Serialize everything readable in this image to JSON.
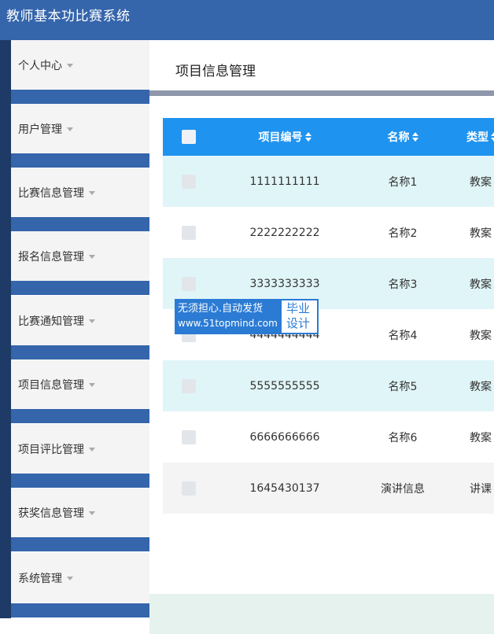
{
  "app": {
    "title": "教师基本功比赛系统"
  },
  "sidebar": {
    "items": [
      {
        "label": "个人中心"
      },
      {
        "label": "用户管理"
      },
      {
        "label": "比赛信息管理"
      },
      {
        "label": "报名信息管理"
      },
      {
        "label": "比赛通知管理"
      },
      {
        "label": "项目信息管理"
      },
      {
        "label": "项目评比管理"
      },
      {
        "label": "获奖信息管理"
      },
      {
        "label": "系统管理"
      }
    ]
  },
  "page": {
    "title": "项目信息管理"
  },
  "table": {
    "columns": [
      {
        "label": "项目编号"
      },
      {
        "label": "名称"
      },
      {
        "label": "类型"
      }
    ],
    "rows": [
      {
        "code": "1111111111",
        "name": "名称1",
        "type": "教案"
      },
      {
        "code": "2222222222",
        "name": "名称2",
        "type": "教案"
      },
      {
        "code": "3333333333",
        "name": "名称3",
        "type": "教案"
      },
      {
        "code": "4444444444",
        "name": "名称4",
        "type": "教案"
      },
      {
        "code": "5555555555",
        "name": "名称5",
        "type": "教案"
      },
      {
        "code": "6666666666",
        "name": "名称6",
        "type": "教案"
      },
      {
        "code": "1645430137",
        "name": "演讲信息",
        "type": "讲课"
      }
    ]
  },
  "watermark": {
    "line1": "无须担心.自动发货",
    "line2": "www.51topmind.com",
    "tag_top": "毕业",
    "tag_bottom": "设计"
  },
  "colors": {
    "header_bg": "#3565ab",
    "table_header_bg": "#1f93f0",
    "row_alt_bg": "#e0f5f7",
    "row_last_bg": "#f4f4f4"
  }
}
